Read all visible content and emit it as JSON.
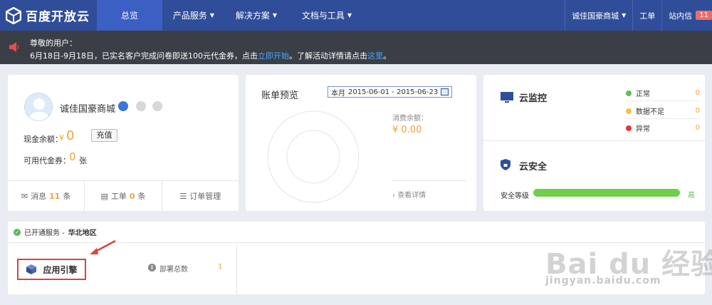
{
  "brand": {
    "name": "百度开放云"
  },
  "nav": {
    "items": [
      {
        "label": "总览",
        "active": true
      },
      {
        "label": "产品服务",
        "dropdown": true
      },
      {
        "label": "解决方案",
        "dropdown": true
      },
      {
        "label": "文档与工具",
        "dropdown": true
      }
    ],
    "account": "诚佳国豪商城",
    "ticket": "工单",
    "inbox": "站内信",
    "inbox_count": "11"
  },
  "notice": {
    "greeting": "尊敬的用户：",
    "text_before": "6月18日-9月18日，已实名客户完成问卷即送100元代金券，点击",
    "start_link": "立即开始",
    "text_middle": "。了解活动详情请点击",
    "detail_link": "这里",
    "text_after": "。"
  },
  "profile": {
    "username": "诚佳国豪商城",
    "cash_label": "现金余额：",
    "currency": "¥",
    "cash_value": "0",
    "recharge": "充值",
    "voucher_label": "可用代金券：",
    "voucher_value": "0",
    "voucher_unit": "张",
    "footer": {
      "messages_label": "消息",
      "messages_count": "11",
      "messages_unit": "条",
      "tickets_label": "工单",
      "tickets_count": "0",
      "tickets_unit": "条",
      "orders_label": "订单管理"
    }
  },
  "bill": {
    "title": "账单预览",
    "period_label": "本月",
    "period": "2015-06-01 - 2015-06-23",
    "balance_label": "消费余额：",
    "balance_value": "¥ 0.00",
    "detail_link": "查看详情"
  },
  "monitor": {
    "title": "云监控",
    "stats": [
      {
        "label": "正常",
        "value": "0",
        "color": "#5cc05c"
      },
      {
        "label": "数据不足",
        "value": "0",
        "color": "#f5c342"
      },
      {
        "label": "异常",
        "value": "0",
        "color": "#e2363c"
      }
    ]
  },
  "security": {
    "title": "云安全",
    "level_label": "安全等级",
    "level_value": "高",
    "level_fraction": 1.0
  },
  "services": {
    "header_label": "已开通服务 -",
    "region": "华北地区",
    "items": [
      {
        "name": "应用引擎",
        "meta_label": "部署总数",
        "count": "1"
      }
    ]
  },
  "watermark": {
    "main": "Bai du 经验",
    "sub": "jingyan.baidu.com"
  },
  "colors": {
    "nav_bg": "#2f4d99",
    "accent": "#f0a23c",
    "notice_bg": "#3a3e46",
    "highlight": "#d6463d"
  }
}
